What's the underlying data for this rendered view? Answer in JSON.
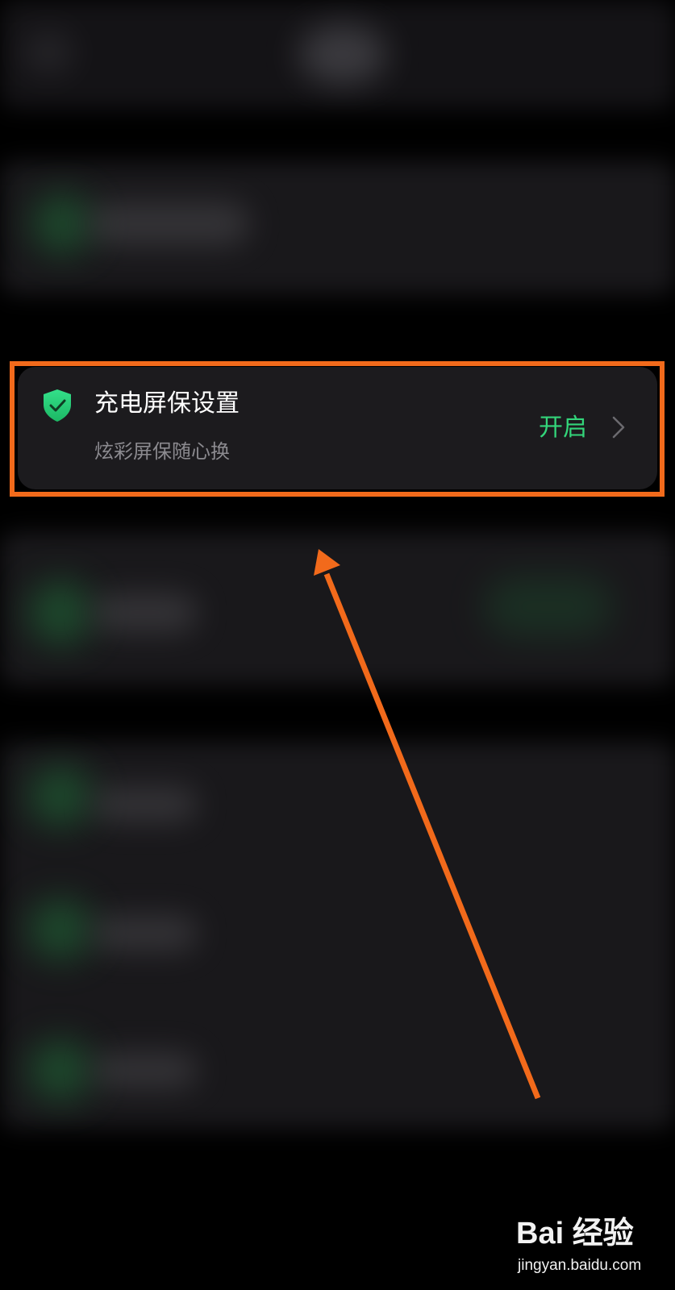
{
  "setting": {
    "title": "充电屏保设置",
    "subtitle": "炫彩屏保随心换",
    "status": "开启"
  },
  "colors": {
    "accent_green": "#33d57a",
    "highlight_orange": "#f26a1b",
    "card_background": "#1c1b1e"
  },
  "icons": {
    "setting_icon": "shield-check-icon",
    "navigate_icon": "chevron-right-icon",
    "annotation": "arrow-up-icon"
  },
  "watermark": {
    "logo": "Bai 经验",
    "site": "jingyan.baidu.com"
  }
}
